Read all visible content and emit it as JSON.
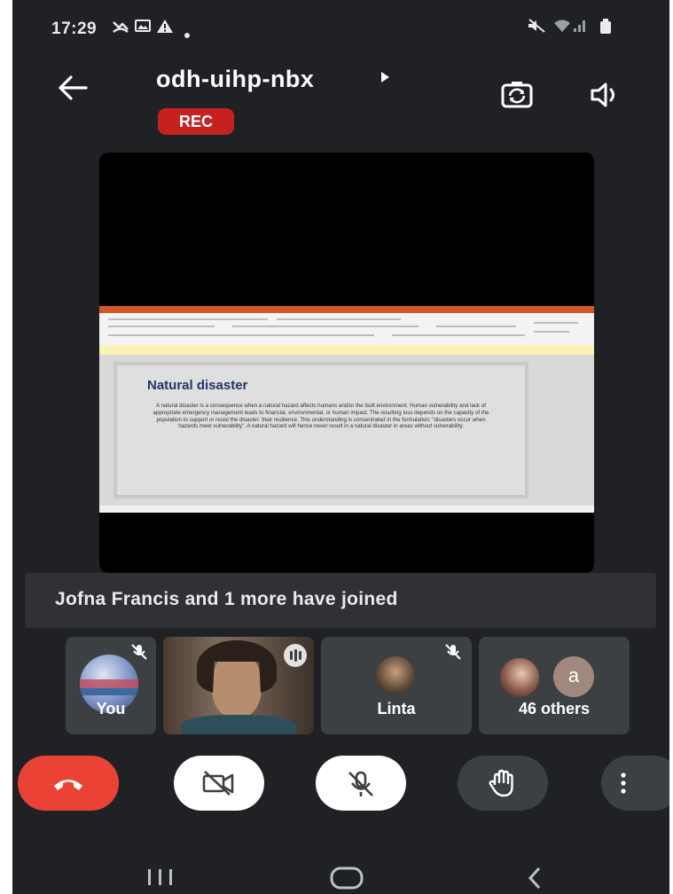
{
  "status_bar": {
    "time": "17:29",
    "left_icons": [
      "missed-call-icon",
      "image-icon",
      "alert-icon",
      "dot-icon"
    ],
    "right_icons": [
      "mute-icon",
      "wifi-icon",
      "signal-icon",
      "battery-icon"
    ]
  },
  "header": {
    "meeting_code": "odh-uihp-nbx",
    "rec_label": "REC",
    "icons": [
      "back-arrow-icon",
      "switch-camera-icon",
      "speaker-icon"
    ]
  },
  "presentation": {
    "slide_title": "Natural disaster",
    "slide_body": "A natural disaster is a consequence when a natural hazard affects humans and/or the built environment. Human vulnerability and lack of appropriate emergency management leads to financial, environmental, or human impact. The resulting loss depends on the capacity of the population to support or resist the disaster: their resilience. This understanding is concentrated in the formulation: \"disasters occur when hazards meet vulnerability\". A natural hazard will hence never result in a natural disaster in areas without vulnerability."
  },
  "notification": {
    "text": "Jofna Francis and 1 more have joined"
  },
  "participants": [
    {
      "label": "You",
      "muted": true
    },
    {
      "label": "",
      "speaking": true
    },
    {
      "label": "Linta",
      "muted": true
    },
    {
      "label": "46 others",
      "avatar_letter": "a"
    }
  ],
  "controls": {
    "icons": [
      "end-call-icon",
      "camera-off-icon",
      "mic-off-icon",
      "raise-hand-icon",
      "more-options-icon"
    ],
    "colors": {
      "end_call": "#ea4335",
      "active_button": "#ffffff",
      "inactive_button": "#3c4043"
    }
  },
  "nav_bar": {
    "icons": [
      "recent-apps-icon",
      "home-icon",
      "back-icon"
    ]
  }
}
